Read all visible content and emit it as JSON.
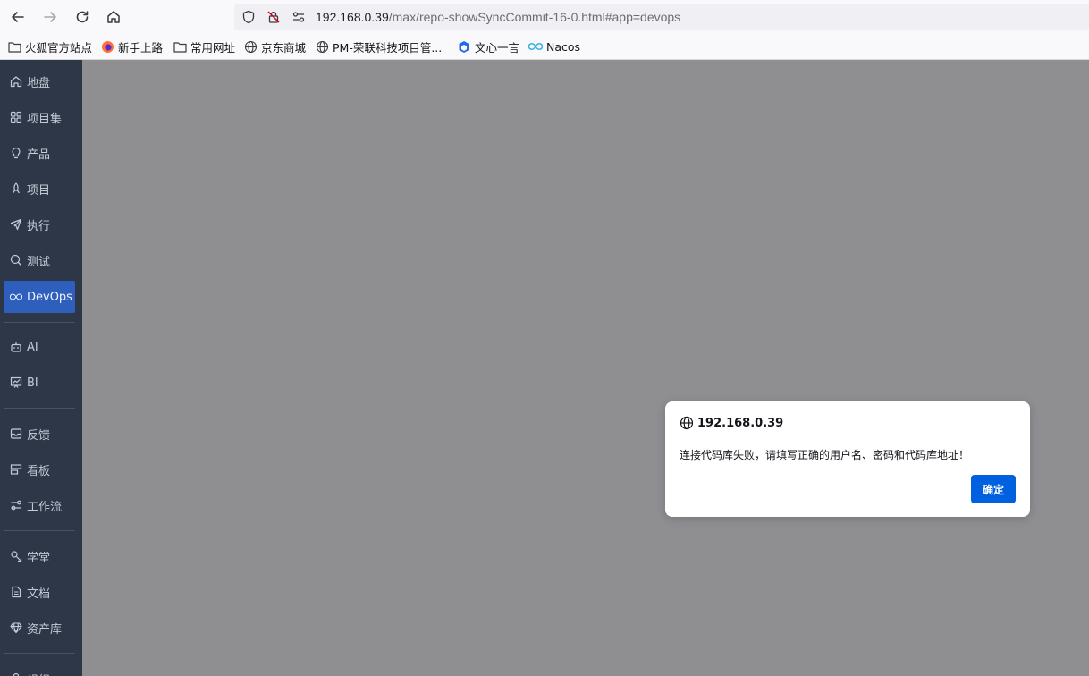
{
  "browser": {
    "url_host": "192.168.0.39",
    "url_path": "/max/repo-showSyncCommit-16-0.html#app=devops"
  },
  "bookmarks": [
    {
      "label": "火狐官方站点",
      "icon": "folder-icon"
    },
    {
      "label": "新手上路",
      "icon": "firefox-icon"
    },
    {
      "label": "常用网址",
      "icon": "folder-icon"
    },
    {
      "label": "京东商城",
      "icon": "globe-icon"
    },
    {
      "label": "PM-荣联科技项目管...",
      "icon": "globe-icon"
    },
    {
      "label": "文心一言",
      "icon": "cube-icon"
    },
    {
      "label": "Nacos",
      "icon": "infinity-icon"
    }
  ],
  "sidebar": {
    "items": [
      {
        "label": "地盘",
        "icon": "home-icon"
      },
      {
        "label": "项目集",
        "icon": "grid-icon"
      },
      {
        "label": "产品",
        "icon": "bulb-icon"
      },
      {
        "label": "项目",
        "icon": "rocket-icon"
      },
      {
        "label": "执行",
        "icon": "send-icon"
      },
      {
        "label": "测试",
        "icon": "search-check-icon"
      },
      {
        "label": "DevOps",
        "icon": "infinity-icon",
        "active": true
      },
      {
        "label": "AI",
        "icon": "robot-icon"
      },
      {
        "label": "BI",
        "icon": "chart-board-icon"
      },
      {
        "label": "反馈",
        "icon": "feedback-icon"
      },
      {
        "label": "看板",
        "icon": "kanban-icon"
      },
      {
        "label": "工作流",
        "icon": "workflow-icon"
      },
      {
        "label": "学堂",
        "icon": "school-icon"
      },
      {
        "label": "文档",
        "icon": "document-icon"
      },
      {
        "label": "资产库",
        "icon": "gem-icon"
      },
      {
        "label": "组织",
        "icon": "org-icon"
      }
    ]
  },
  "dialog": {
    "origin": "192.168.0.39",
    "message": "连接代码库失败，请填写正确的用户名、密码和代码库地址！",
    "ok_label": "确定"
  },
  "colors": {
    "sidebar_bg": "#2d3748",
    "active_item": "#2f5fbd",
    "overlay": "#8f8f92",
    "ok_button": "#0061e0"
  }
}
